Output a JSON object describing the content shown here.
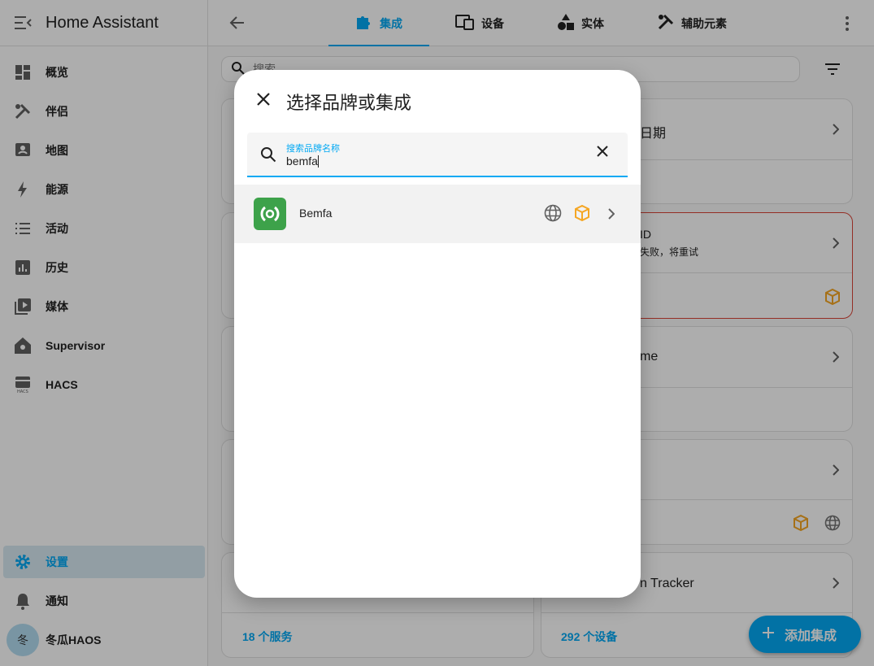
{
  "app": {
    "title": "Home Assistant"
  },
  "sidebar": {
    "items": [
      {
        "label": "概览",
        "icon": "dashboard-icon"
      },
      {
        "label": "伴侣",
        "icon": "tools-icon"
      },
      {
        "label": "地图",
        "icon": "map-icon"
      },
      {
        "label": "能源",
        "icon": "lightning-icon"
      },
      {
        "label": "活动",
        "icon": "list-icon"
      },
      {
        "label": "历史",
        "icon": "chart-icon"
      },
      {
        "label": "媒体",
        "icon": "media-icon"
      },
      {
        "label": "Supervisor",
        "icon": "supervisor-icon"
      },
      {
        "label": "HACS",
        "icon": "hacs-icon"
      }
    ],
    "settings": "设置",
    "notifications": "通知",
    "user": {
      "initial": "冬",
      "name": "冬瓜HAOS"
    }
  },
  "tabs": [
    {
      "label": "集成",
      "icon": "puzzle-icon"
    },
    {
      "label": "设备",
      "icon": "devices-icon"
    },
    {
      "label": "实体",
      "icon": "shapes-icon"
    },
    {
      "label": "辅助元素",
      "icon": "tools-icon"
    }
  ],
  "search": {
    "placeholder": "搜索"
  },
  "background_cards": {
    "c1_title": "日期",
    "c2_title": "ID",
    "c2_status": "失败，将重试",
    "c3_title": "me",
    "c5_title": "n Tracker",
    "c5_left_link": "18 个服务",
    "c5_right_link": "292 个设备"
  },
  "fab": {
    "label": "添加集成"
  },
  "dialog": {
    "title": "选择品牌或集成",
    "field_label": "搜索品牌名称",
    "field_value": "bemfa",
    "results": [
      {
        "name": "Bemfa"
      }
    ]
  },
  "colors": {
    "accent": "#03a9f4",
    "custom_badge": "#f5a623",
    "error": "#db4437",
    "brand_logo": "#3da24a"
  }
}
